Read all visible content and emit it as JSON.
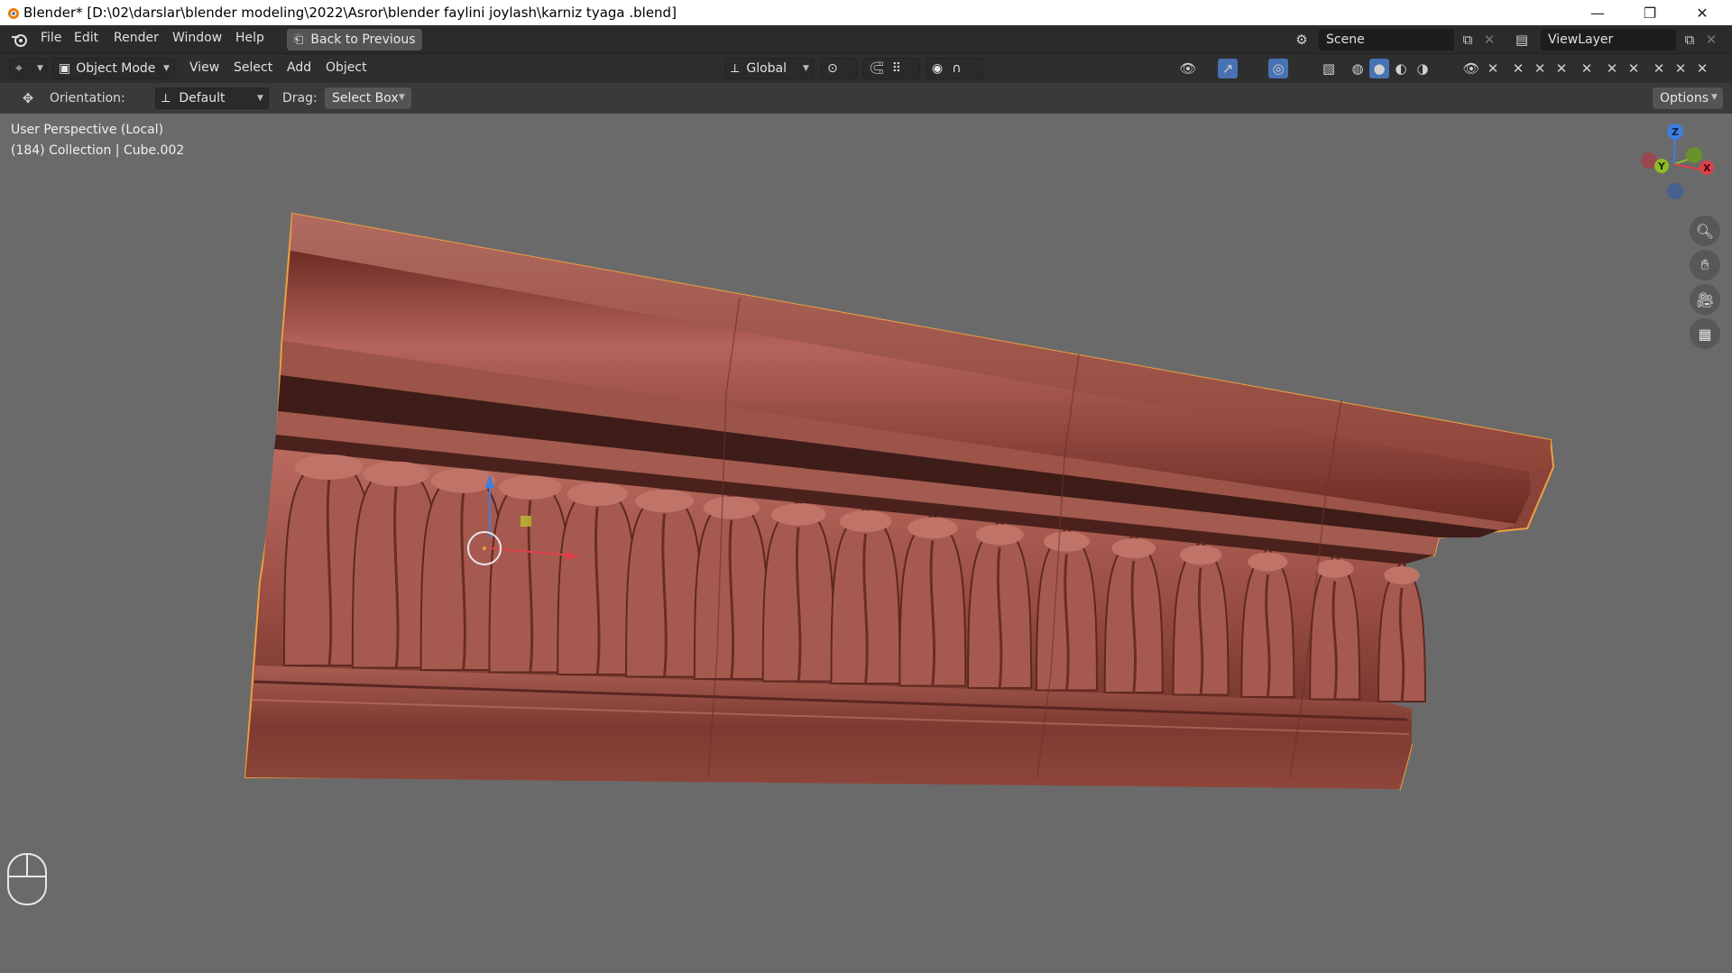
{
  "window": {
    "title": "Blender* [D:\\02\\darslar\\blender modeling\\2022\\Asror\\blender faylini joylash\\karniz tyaga .blend]",
    "minimize": "—",
    "maximize": "❐",
    "close": "✕"
  },
  "menu": {
    "items": [
      "File",
      "Edit",
      "Render",
      "Window",
      "Help"
    ],
    "back_button": "Back to Previous",
    "scene_label": "Scene",
    "viewlayer_label": "ViewLayer"
  },
  "header": {
    "mode": "Object Mode",
    "menus": [
      "View",
      "Select",
      "Add",
      "Object"
    ],
    "transform_orientation": "Global"
  },
  "tool_header": {
    "orientation_label": "Orientation:",
    "orientation_value": "Default",
    "drag_label": "Drag:",
    "drag_value": "Select Box",
    "options": "Options"
  },
  "viewport": {
    "view_name": "User Perspective (Local)",
    "object_info": "(184) Collection | Cube.002",
    "gizmo_axes": [
      "Z",
      "Y",
      "X"
    ],
    "model_color": "#a8574c"
  },
  "colors": {
    "x_axis": "#e0404a",
    "y_axis": "#8cbd26",
    "z_axis": "#3d7fe0",
    "selection_outline": "#f0a040"
  }
}
